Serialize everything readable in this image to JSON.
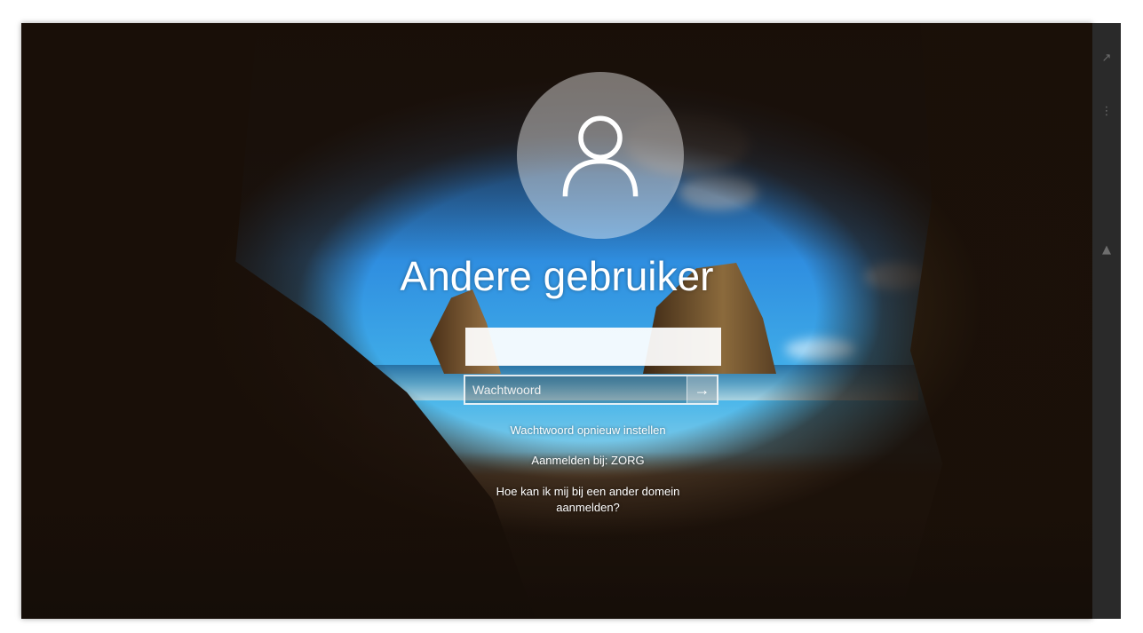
{
  "login": {
    "username": "Andere gebruiker",
    "password_placeholder": "Wachtwoord",
    "submit_glyph": "→"
  },
  "links": {
    "reset_password": "Wachtwoord opnieuw instellen",
    "sign_in_to": "Aanmelden bij: ZORG",
    "other_domain_line1": "Hoe kan ik mij bij een ander domein",
    "other_domain_line2": "aanmelden?"
  },
  "side_strip": {
    "icons": [
      "external-link-icon",
      "more-vertical-icon",
      "warning-icon"
    ]
  },
  "colors": {
    "accent_text": "#ffffff",
    "sky": "#2f8ee0"
  }
}
